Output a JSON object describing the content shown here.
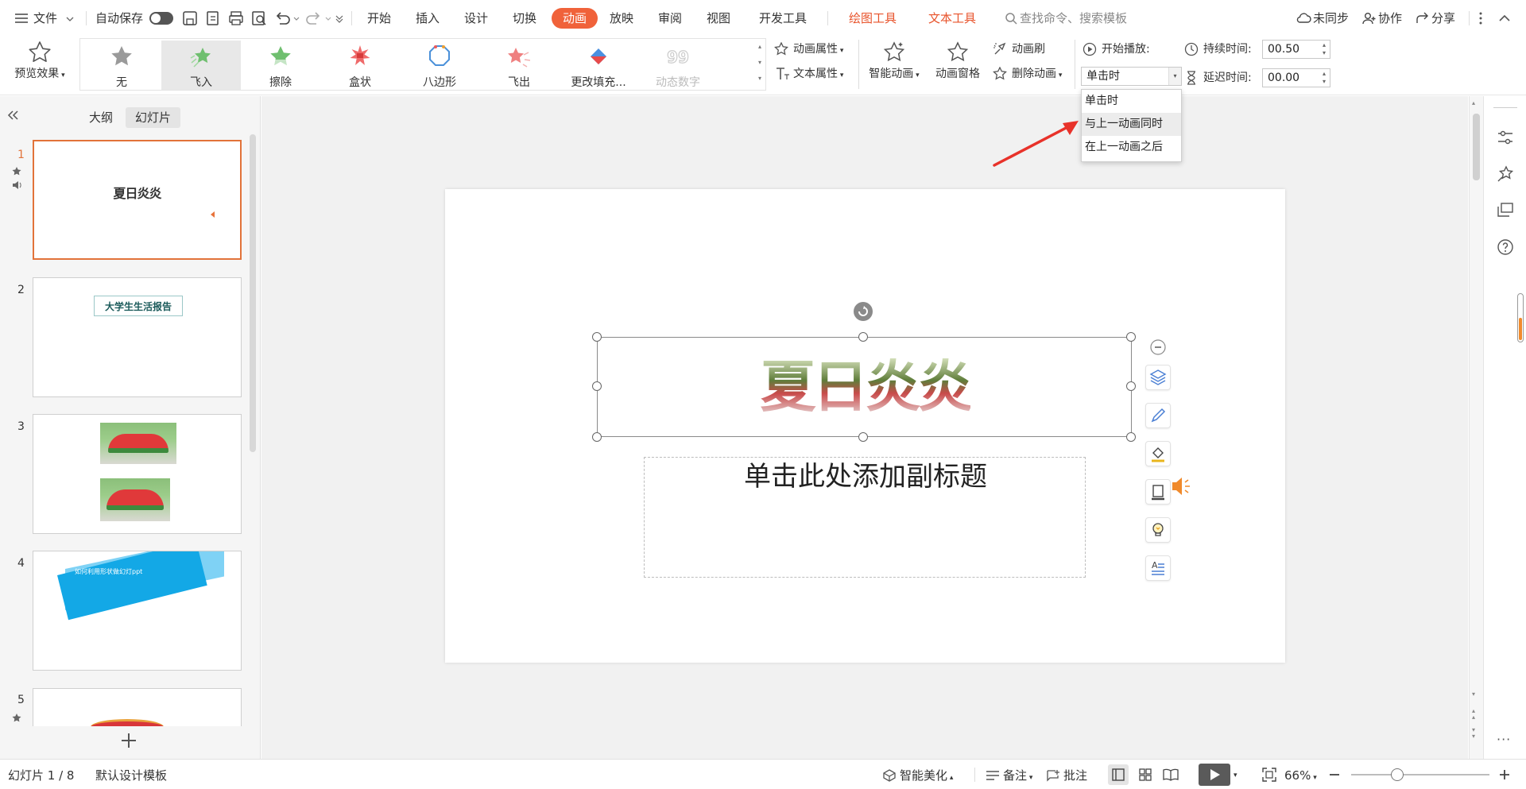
{
  "menubar": {
    "file": "文件",
    "autosave": "自动保存",
    "tabs": [
      "开始",
      "插入",
      "设计",
      "切换",
      "动画",
      "放映",
      "审阅",
      "视图",
      "开发工具"
    ],
    "context_tabs": [
      "绘图工具",
      "文本工具"
    ],
    "search_placeholder": "查找命令、搜索模板",
    "sync": "未同步",
    "collab": "协作",
    "share": "分享"
  },
  "ribbon": {
    "preview": "预览效果",
    "gallery": [
      "无",
      "飞入",
      "擦除",
      "盒状",
      "八边形",
      "飞出",
      "更改填充...",
      "动态数字"
    ],
    "anim_props": "动画属性",
    "text_props": "文本属性",
    "smart_anim": "智能动画",
    "anim_pane": "动画窗格",
    "anim_brush": "动画刷",
    "delete_anim": "删除动画",
    "start_label": "开始播放:",
    "start_value": "单击时",
    "duration_label": "持续时间:",
    "duration_value": "00.50",
    "delay_label": "延迟时间:",
    "delay_value": "00.00"
  },
  "dropdown": {
    "options": [
      "单击时",
      "与上一动画同时",
      "在上一动画之后"
    ],
    "hover_index": 1
  },
  "leftpanel": {
    "tabs": [
      "大纲",
      "幻灯片"
    ],
    "active_tab": 1,
    "slides": [
      {
        "num": "1",
        "text": "夏日炎炎"
      },
      {
        "num": "2",
        "text": "大学生生活报告"
      },
      {
        "num": "3",
        "text": ""
      },
      {
        "num": "4",
        "text": "如何利用形状做幻灯ppt"
      },
      {
        "num": "5",
        "text": ""
      }
    ]
  },
  "slide": {
    "title": "夏日炎炎",
    "subtitle": "单击此处添加副标题"
  },
  "statusbar": {
    "slide_info": "幻灯片 1 / 8",
    "template": "默认设计模板",
    "beautify": "智能美化",
    "notes": "备注",
    "comments": "批注",
    "zoom": "66%"
  },
  "colors": {
    "accent": "#f0623a",
    "context_tab": "#e8532b",
    "selected_border": "#e2733a",
    "arrow": "#e8322a"
  }
}
